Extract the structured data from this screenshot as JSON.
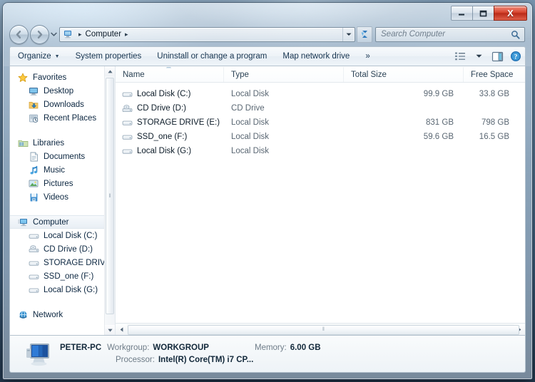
{
  "window": {
    "titlebar": {
      "minimize_label": "Minimize",
      "maximize_label": "Maximize",
      "close_label": "X"
    }
  },
  "address": {
    "crumb": "Computer",
    "separator": "▸",
    "dropdown_caret": "▼",
    "refresh_label": "Refresh"
  },
  "search": {
    "placeholder": "Search Computer"
  },
  "toolbar": {
    "organize_label": "Organize",
    "organize_caret": "▼",
    "system_properties_label": "System properties",
    "uninstall_label": "Uninstall or change a program",
    "map_drive_label": "Map network drive",
    "overflow_label": "»",
    "views_caret": "▼"
  },
  "sidebar": {
    "groups": [
      {
        "label": "Favorites",
        "icon": "star-icon",
        "items": [
          {
            "label": "Desktop",
            "icon": "desktop-icon"
          },
          {
            "label": "Downloads",
            "icon": "downloads-icon"
          },
          {
            "label": "Recent Places",
            "icon": "recent-places-icon"
          }
        ]
      },
      {
        "label": "Libraries",
        "icon": "libraries-icon",
        "items": [
          {
            "label": "Documents",
            "icon": "documents-icon"
          },
          {
            "label": "Music",
            "icon": "music-icon"
          },
          {
            "label": "Pictures",
            "icon": "pictures-icon"
          },
          {
            "label": "Videos",
            "icon": "videos-icon"
          }
        ]
      },
      {
        "label": "Computer",
        "icon": "computer-icon",
        "selected": true,
        "items": [
          {
            "label": "Local Disk (C:)",
            "icon": "drive-icon"
          },
          {
            "label": "CD Drive (D:)",
            "icon": "cd-drive-icon"
          },
          {
            "label": "STORAGE DRIVE (",
            "icon": "drive-icon"
          },
          {
            "label": "SSD_one (F:)",
            "icon": "drive-icon"
          },
          {
            "label": "Local Disk (G:)",
            "icon": "drive-icon"
          }
        ]
      },
      {
        "label": "Network",
        "icon": "network-icon",
        "items": []
      }
    ]
  },
  "filelist": {
    "columns": [
      {
        "key": "name",
        "label": "Name",
        "sorted": "asc"
      },
      {
        "key": "type",
        "label": "Type"
      },
      {
        "key": "size",
        "label": "Total Size"
      },
      {
        "key": "free",
        "label": "Free Space"
      }
    ],
    "sort_indicator": "▲",
    "rows": [
      {
        "name": "Local Disk (C:)",
        "icon": "drive-icon",
        "type": "Local Disk",
        "size": "99.9 GB",
        "free": "33.8 GB"
      },
      {
        "name": "CD Drive (D:)",
        "icon": "cd-drive-icon",
        "type": "CD Drive",
        "size": "",
        "free": ""
      },
      {
        "name": "STORAGE DRIVE (E:)",
        "icon": "drive-icon",
        "type": "Local Disk",
        "size": "831 GB",
        "free": "798 GB"
      },
      {
        "name": "SSD_one (F:)",
        "icon": "drive-icon",
        "type": "Local Disk",
        "size": "59.6 GB",
        "free": "16.5 GB"
      },
      {
        "name": "Local Disk (G:)",
        "icon": "drive-icon",
        "type": "Local Disk",
        "size": "",
        "free": ""
      }
    ]
  },
  "scrollbars": {
    "up_arrow": "▲",
    "down_arrow": "▼",
    "left_arrow": "◀",
    "right_arrow": "▶",
    "grip": "‖"
  },
  "details": {
    "computer_name": "PETER-PC",
    "workgroup_label": "Workgroup:",
    "workgroup_value": "WORKGROUP",
    "memory_label": "Memory:",
    "memory_value": "6.00 GB",
    "processor_label": "Processor:",
    "processor_value": "Intel(R) Core(TM) i7 CP..."
  }
}
